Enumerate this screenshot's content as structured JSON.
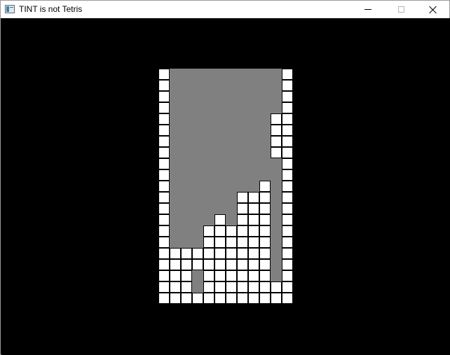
{
  "window": {
    "title": "TINT is not Tetris",
    "icon": "app-window-icon",
    "controls": [
      "minimize-icon",
      "maximize-icon",
      "close-icon"
    ]
  },
  "colors": {
    "background": "#000000",
    "well": "#808080",
    "block_fill": "#ffffff",
    "block_border": "#000000"
  },
  "board": {
    "cols": 12,
    "rows": 21,
    "legend": "B = wall/locked block, . = empty well",
    "grid": [
      "B..........B",
      "B..........B",
      "B..........B",
      "B..........B",
      "B.........BB",
      "B.........BB",
      "B.........BB",
      "B.........BB",
      "B..........B",
      "B..........B",
      "B........B.B",
      "B......BBB.B",
      "B......BBB.B",
      "B....B.BBB.B",
      "B...BBBBBB.B",
      "B...BBBBBB.B",
      "BBBBBBBBBB.B",
      "BBBBBBBBBB.B",
      "BBB.BBBBBB.B",
      "BBB.BBBBBBBB",
      "BBBBBBBBBBBB"
    ]
  }
}
